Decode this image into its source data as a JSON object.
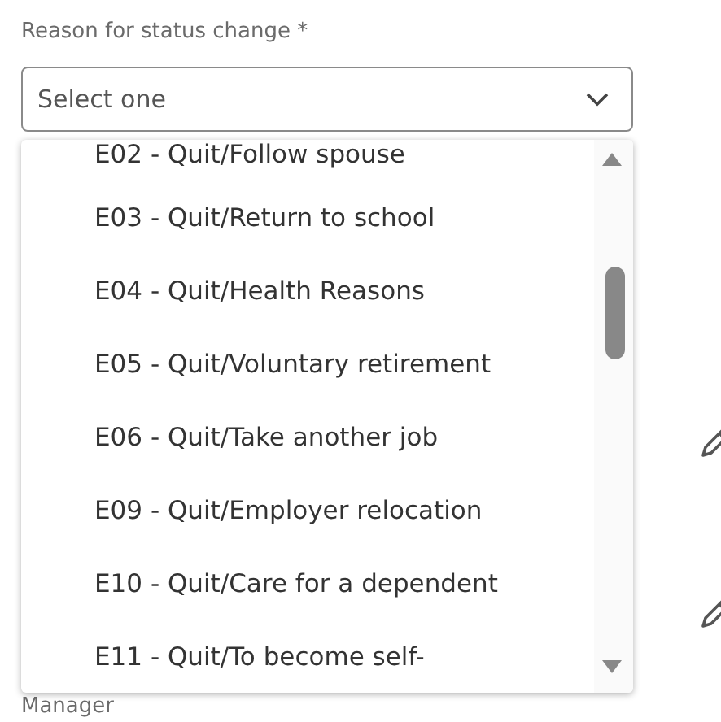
{
  "field": {
    "label": "Reason for status change *",
    "placeholder": "Select one"
  },
  "options": [
    {
      "label": "E02 - Quit/Follow spouse"
    },
    {
      "label": "E03 - Quit/Return to school"
    },
    {
      "label": "E04 - Quit/Health Reasons"
    },
    {
      "label": "E05 - Quit/Voluntary retirement"
    },
    {
      "label": "E06 - Quit/Take another job"
    },
    {
      "label": "E09 - Quit/Employer relocation"
    },
    {
      "label": "E10 - Quit/Care for a dependent"
    },
    {
      "label": "E11 - Quit/To become self-"
    }
  ],
  "next_label": "Manager"
}
